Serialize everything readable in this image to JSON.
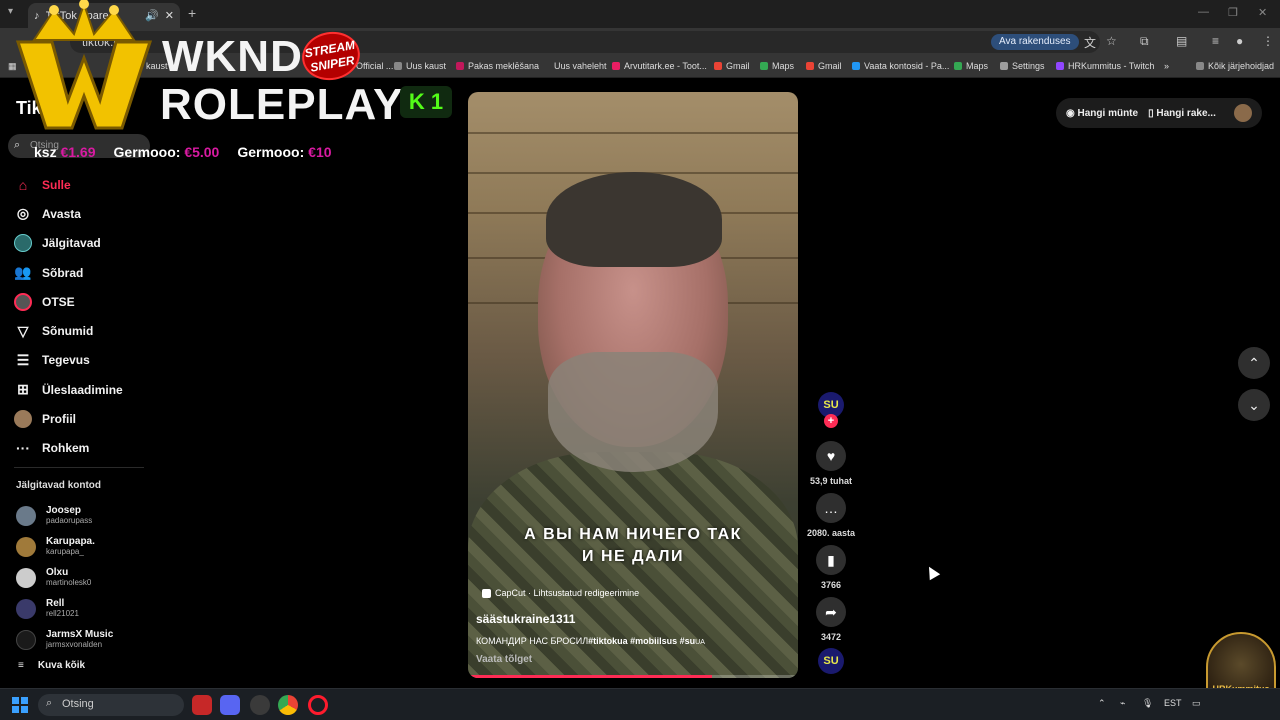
{
  "browser": {
    "tab_title": "TikTok - pare",
    "url": "tiktok.com",
    "open_app_chip": "Ava rakenduses",
    "bookmarks": [
      {
        "label": "kaust",
        "color": "#e6c200"
      },
      {
        "label": "Official ...",
        "color": "#d02020"
      },
      {
        "label": "Uus kaust",
        "color": "#888888"
      },
      {
        "label": "Pakas meklēšana",
        "color": "#c2185b"
      },
      {
        "label": "Uus vaheleht",
        "color": "#666666"
      },
      {
        "label": "Arvutitark.ee - Toot...",
        "color": "#e91e63"
      },
      {
        "label": "Gmail",
        "color": "#ea4335"
      },
      {
        "label": "Maps",
        "color": "#34a853"
      },
      {
        "label": "Gmail",
        "color": "#ea4335"
      },
      {
        "label": "Vaata kontosid - Pa...",
        "color": "#2196f3"
      },
      {
        "label": "Maps",
        "color": "#34a853"
      },
      {
        "label": "Settings",
        "color": "#9e9e9e"
      },
      {
        "label": "HRKummitus - Twitch",
        "color": "#9146ff"
      }
    ],
    "all_bookmarks": "Kõik järjehoidjad"
  },
  "overlay": {
    "title_line1": "WKND",
    "title_line2": "ROLEPLAY",
    "sniper_badge": "STREAM SNIPER",
    "kick_logo": "K",
    "kick_count": "1",
    "donations": [
      {
        "name": "ksz",
        "amount": "€1.69"
      },
      {
        "name": "Germooo",
        "amount": "€5.00"
      },
      {
        "name": "Germooo",
        "amount": "€10"
      }
    ]
  },
  "tiktok": {
    "logo": "TikTok",
    "search_placeholder": "Otsing",
    "nav": [
      {
        "label": "Sulle",
        "icon": "home-icon",
        "active": true
      },
      {
        "label": "Avasta",
        "icon": "compass-icon"
      },
      {
        "label": "Jälgitavad",
        "icon": "avatar"
      },
      {
        "label": "Sõbrad",
        "icon": "friends-icon"
      },
      {
        "label": "OTSE",
        "icon": "live-avatar"
      },
      {
        "label": "Sõnumid",
        "icon": "message-icon"
      },
      {
        "label": "Tegevus",
        "icon": "activity-icon"
      },
      {
        "label": "Üleslaadimine",
        "icon": "upload-icon"
      },
      {
        "label": "Profiil",
        "icon": "profile-avatar"
      },
      {
        "label": "Rohkem",
        "icon": "more-icon"
      }
    ],
    "following_title": "Jälgitavad kontod",
    "following": [
      {
        "name": "Joosep",
        "id": "padaorupass",
        "color": "#6a7a8a"
      },
      {
        "name": "Karupapa.",
        "id": "karupapa_",
        "color": "#a07a3a"
      },
      {
        "name": "Olxu",
        "id": "martinolesk0",
        "color": "#cccccc"
      },
      {
        "name": "Rell",
        "id": "rell21021",
        "color": "#3a3a6a"
      },
      {
        "name": "JarmsX Music",
        "id": "jarmsxvonalden",
        "color": "#1a1a1a"
      }
    ],
    "see_all": "Kuva kõik",
    "top_right": {
      "coins": "Hangi münte",
      "app": "Hangi rake..."
    }
  },
  "video": {
    "subtitle_line1": "А ВЫ НАМ НИЧЕГО ТАК",
    "subtitle_line2": "И НЕ ДАЛИ",
    "capcut": "CapCut · Lihtsustatud redigeerimine",
    "author": "säästukraine1311",
    "description_text": "КОМАНДИР НАС БРОСИЛ",
    "description_tags": "#tiktokua #mobiilsus #su",
    "description_tail": "UA",
    "translate": "Vaata tõlget",
    "progress": 0.74,
    "likes": "53,9 tuhat",
    "comments": "2080. aasta",
    "saves": "3766",
    "shares": "3472",
    "creator_avatar_text": "SU"
  },
  "streamer_badge": "HRKummitus",
  "taskbar": {
    "search": "Otsing",
    "lang": "EST",
    "apps": [
      {
        "name": "news-app",
        "color": "#c62828"
      },
      {
        "name": "discord-app",
        "color": "#5865f2"
      },
      {
        "name": "obs-app",
        "color": "#3a3a3a"
      },
      {
        "name": "chrome-app",
        "color": "#f4b400"
      },
      {
        "name": "opera-app",
        "color": "#ff1b2d"
      }
    ]
  }
}
